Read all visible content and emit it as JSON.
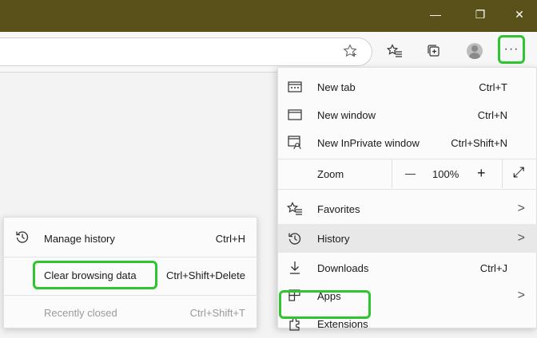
{
  "titlebar": {
    "minimize": "—",
    "restore": "❐",
    "close": "✕"
  },
  "toolbar": {
    "more_label": "···"
  },
  "menu": {
    "items": [
      {
        "label": "New tab",
        "shortcut": "Ctrl+T"
      },
      {
        "label": "New window",
        "shortcut": "Ctrl+N"
      },
      {
        "label": "New InPrivate window",
        "shortcut": "Ctrl+Shift+N"
      }
    ],
    "zoom": {
      "label": "Zoom",
      "minus": "—",
      "value": "100%",
      "plus": "+",
      "expand": "⤢"
    },
    "favorites": {
      "label": "Favorites",
      "arrow": ">"
    },
    "history": {
      "label": "History",
      "arrow": ">"
    },
    "downloads": {
      "label": "Downloads",
      "shortcut": "Ctrl+J"
    },
    "apps": {
      "label": "Apps",
      "arrow": ">"
    },
    "extensions": {
      "label": "Extensions"
    }
  },
  "submenu": {
    "manage": {
      "label": "Manage history",
      "shortcut": "Ctrl+H"
    },
    "clear": {
      "label": "Clear browsing data",
      "shortcut": "Ctrl+Shift+Delete"
    },
    "recent": {
      "label": "Recently closed",
      "shortcut": "Ctrl+Shift+T"
    }
  },
  "colors": {
    "titlebar": "#5a511a",
    "highlight": "#2ec52e"
  }
}
